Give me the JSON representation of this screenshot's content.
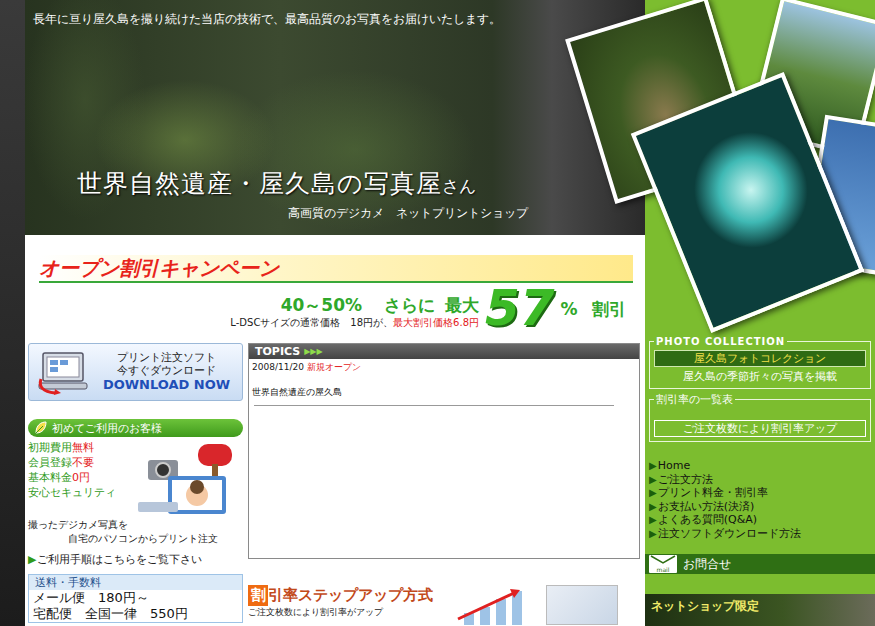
{
  "header": {
    "tagline": "長年に亘り屋久島を撮り続けた当店の技術で、最高品質のお写真をお届けいたします。",
    "title": "世界自然遺産・屋久島の写真屋",
    "title_suffix": "さん",
    "subtitle": "高画質のデジカメ　ネットプリントショップ"
  },
  "campaign": {
    "title": "オープン割引キャンペーン",
    "range": "40～50%",
    "more": "さらに",
    "max": "最大",
    "big": "57",
    "percent": "%",
    "discount": "割引",
    "note": "L-DSCサイズの通常価格　18円が、",
    "note_red": "最大割引価格6.8円"
  },
  "download": {
    "line1": "プリント注文ソフト",
    "line2": "今すぐダウンロード",
    "button": "DOWNLOAD NOW"
  },
  "first_time": {
    "title": "初めてご利用のお客様",
    "features": [
      {
        "text": "初期費用",
        "highlight": "無料"
      },
      {
        "text": "会員登録",
        "highlight": "不要"
      },
      {
        "text": "基本料金",
        "highlight": "0円"
      },
      {
        "text": "安心セキュリティ"
      }
    ],
    "desc": [
      "撮ったデジカメ写真を",
      "自宅のパソコンからプリント注文"
    ],
    "link_icon": "▶",
    "link": "ご利用手順はこちらをご覧下さい"
  },
  "shipping": {
    "title": "送料・手数料",
    "rows": [
      "メール便　180円～",
      "宅配便　全国一律　550円"
    ]
  },
  "topics": {
    "title": "TOPICS",
    "arrows": "▶▶▶",
    "items": [
      {
        "date": "2008/11/20",
        "tag": "新規オープン",
        "text": "世界自然遺産の屋久島"
      }
    ]
  },
  "stepup": {
    "icon": "割",
    "title": "引率ステップアップ方式",
    "note": "ご注文枚数により割引率がアップ"
  },
  "photo_collection": {
    "title": "PHOTO COLLECTION",
    "link": "屋久島フォトコレクション",
    "desc": "屋久島の季節折々の写真を掲載"
  },
  "discount_table": {
    "title": "割引率の一覧表",
    "link": "ご注文枚数により割引率アップ"
  },
  "nav": {
    "bullet": "▶",
    "items": [
      "Home",
      "ご注文方法",
      "プリント料金・割引率",
      "お支払い方法(決済)",
      "よくある質問(Q&A)",
      "注文ソフトダウンロード方法"
    ]
  },
  "contact": {
    "icon_text": "mail",
    "label": "お問合せ"
  },
  "limited": "ネットショップ限定"
}
